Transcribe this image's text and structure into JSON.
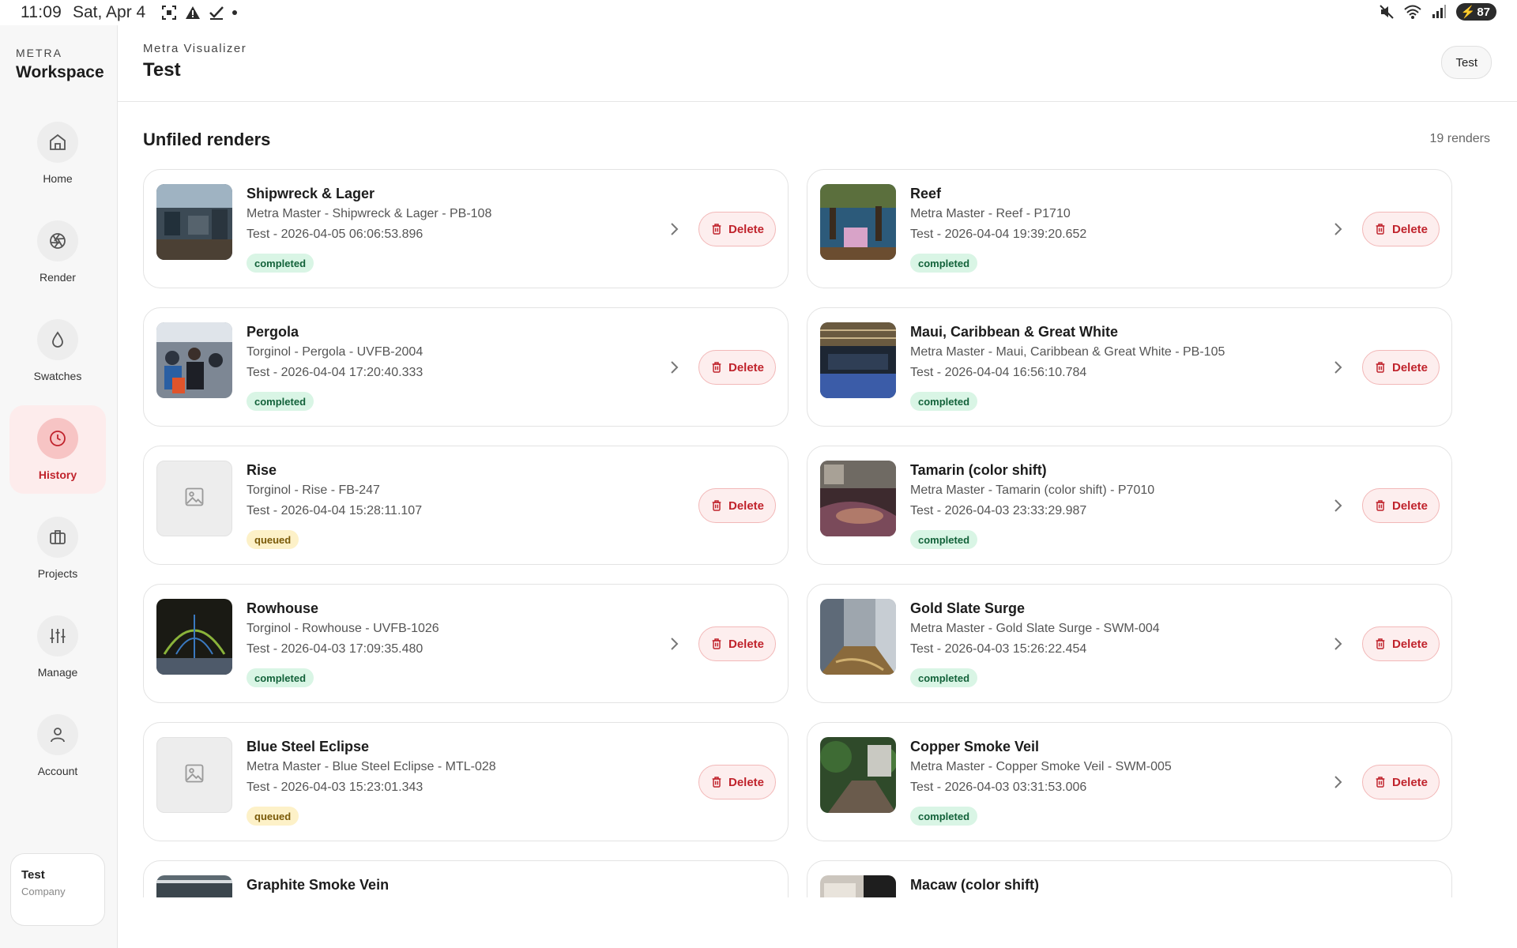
{
  "status_bar": {
    "time": "11:09",
    "date": "Sat, Apr 4",
    "battery": "87"
  },
  "sidebar": {
    "brand_small": "METRA",
    "brand_big": "Workspace",
    "items": [
      {
        "label": "Home",
        "icon": "home-icon"
      },
      {
        "label": "Render",
        "icon": "aperture-icon"
      },
      {
        "label": "Swatches",
        "icon": "droplet-icon"
      },
      {
        "label": "History",
        "icon": "clock-icon",
        "active": true
      },
      {
        "label": "Projects",
        "icon": "briefcase-icon"
      },
      {
        "label": "Manage",
        "icon": "sliders-icon"
      },
      {
        "label": "Account",
        "icon": "user-icon"
      }
    ],
    "user": {
      "name": "Test",
      "company": "Company"
    }
  },
  "header": {
    "app_name": "Metra Visualizer",
    "title": "Test",
    "workspace_button": "Test"
  },
  "main": {
    "section_title": "Unfiled renders",
    "count": "19 renders",
    "delete_label": "Delete",
    "renders": [
      {
        "title": "Shipwreck & Lager",
        "subtitle": "Metra Master - Shipwreck & Lager - PB-108",
        "meta": "Test - 2026-04-05 06:06:53.896",
        "status": "completed",
        "thumb": "office"
      },
      {
        "title": "Reef",
        "subtitle": "Metra Master - Reef - P1710",
        "meta": "Test - 2026-04-04 19:39:20.652",
        "status": "completed",
        "thumb": "pool"
      },
      {
        "title": "Pergola",
        "subtitle": "Torginol - Pergola - UVFB-2004",
        "meta": "Test - 2026-04-04 17:20:40.333",
        "status": "completed",
        "thumb": "crowd"
      },
      {
        "title": "Maui, Caribbean & Great White",
        "subtitle": "Metra Master - Maui, Caribbean & Great White - PB-105",
        "meta": "Test - 2026-04-04 16:56:10.784",
        "status": "completed",
        "thumb": "hall"
      },
      {
        "title": "Rise",
        "subtitle": "Torginol - Rise - FB-247",
        "meta": "Test - 2026-04-04 15:28:11.107",
        "status": "queued",
        "thumb": ""
      },
      {
        "title": "Tamarin (color shift)",
        "subtitle": "Metra Master - Tamarin (color shift) - P7010",
        "meta": "Test - 2026-04-03 23:33:29.987",
        "status": "completed",
        "thumb": "floor"
      },
      {
        "title": "Rowhouse",
        "subtitle": "Torginol - Rowhouse - UVFB-1026",
        "meta": "Test - 2026-04-03 17:09:35.480",
        "status": "completed",
        "thumb": "dome"
      },
      {
        "title": "Gold Slate Surge",
        "subtitle": "Metra Master - Gold Slate Surge - SWM-004",
        "meta": "Test - 2026-04-03 15:26:22.454",
        "status": "completed",
        "thumb": "corridor"
      },
      {
        "title": "Blue Steel Eclipse",
        "subtitle": "Metra Master - Blue Steel Eclipse - MTL-028",
        "meta": "Test - 2026-04-03 15:23:01.343",
        "status": "queued",
        "thumb": ""
      },
      {
        "title": "Copper Smoke Veil",
        "subtitle": "Metra Master - Copper Smoke Veil - SWM-005",
        "meta": "Test - 2026-04-03 03:31:53.006",
        "status": "completed",
        "thumb": "garden"
      },
      {
        "title": "Graphite Smoke Vein",
        "subtitle": "",
        "meta": "",
        "status": "",
        "thumb": "ceiling"
      },
      {
        "title": "Macaw (color shift)",
        "subtitle": "",
        "meta": "",
        "status": "",
        "thumb": "room"
      }
    ]
  }
}
